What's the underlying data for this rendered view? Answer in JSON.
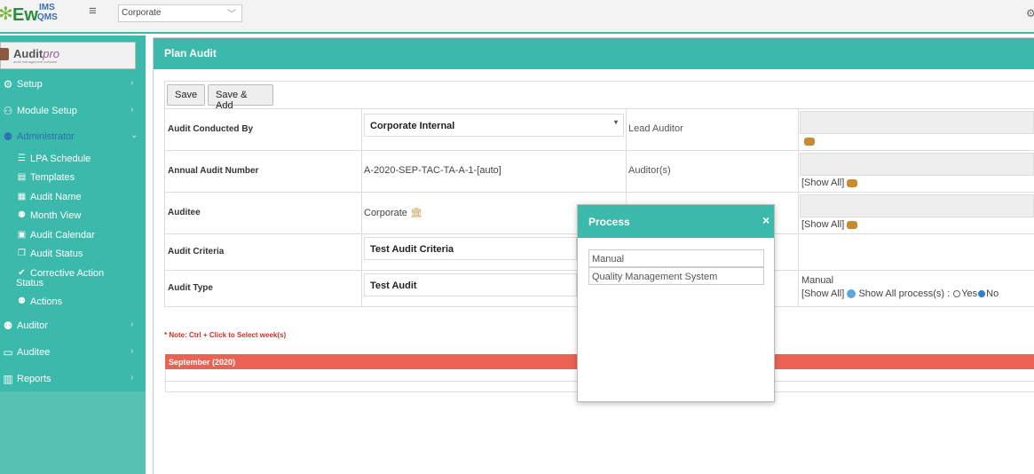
{
  "topbar": {
    "logo_ew": "Ew",
    "logo_ims": "IMS",
    "logo_qms": "QMS",
    "company_select": "Corporate"
  },
  "sidebar": {
    "brand": {
      "name": "Audit",
      "suffix": "pro",
      "tagline": "audit management software"
    },
    "items": [
      {
        "label": "Setup",
        "icon": "gear-icon"
      },
      {
        "label": "Module Setup",
        "icon": "users-gear-icon"
      },
      {
        "label": "Administrator",
        "icon": "user-gear-icon"
      }
    ],
    "subitems": [
      {
        "label": "LPA Schedule",
        "icon": "list-icon"
      },
      {
        "label": "Templates",
        "icon": "document-icon"
      },
      {
        "label": "Audit Name",
        "icon": "calendar-icon"
      },
      {
        "label": "Month View",
        "icon": "user-plus-icon"
      },
      {
        "label": "Audit Calendar",
        "icon": "calendar-check-icon"
      },
      {
        "label": "Audit Status",
        "icon": "copy-icon"
      },
      {
        "label": "Corrective Action",
        "label2": "Status",
        "icon": "check-icon"
      },
      {
        "label": "Actions",
        "icon": "users-icon"
      }
    ],
    "items2": [
      {
        "label": "Auditor",
        "icon": "user-check-icon"
      },
      {
        "label": "Auditee",
        "icon": "id-card-icon"
      },
      {
        "label": "Reports",
        "icon": "building-icon"
      }
    ]
  },
  "panel": {
    "title": "Plan Audit",
    "buttons": {
      "save": "Save",
      "save_add": "Save & Add"
    },
    "fields": {
      "conducted_by": {
        "label": "Audit Conducted By",
        "value": "Corporate Internal"
      },
      "annual_number": {
        "label": "Annual Audit Number",
        "value": "A-2020-SEP-TAC-TA-A-1-[auto]"
      },
      "auditee": {
        "label": "Auditee",
        "value": "Corporate"
      },
      "criteria": {
        "label": "Audit Criteria",
        "value": "Test Audit Criteria"
      },
      "type": {
        "label": "Audit Type",
        "value": "Test Audit"
      }
    },
    "right": {
      "lead_auditor": "Lead Auditor",
      "auditors": "Auditor(s)",
      "show_all": "[Show All]",
      "process_value": "Manual",
      "show_all_process": "Show All process(s) :",
      "yes": "Yes",
      "no": "No"
    },
    "note": "* Note: Ctrl + Click to Select week(s)",
    "month": "September (2020)"
  },
  "modal": {
    "title": "Process",
    "close": "×",
    "items": [
      "Manual",
      "Quality Management System"
    ]
  }
}
